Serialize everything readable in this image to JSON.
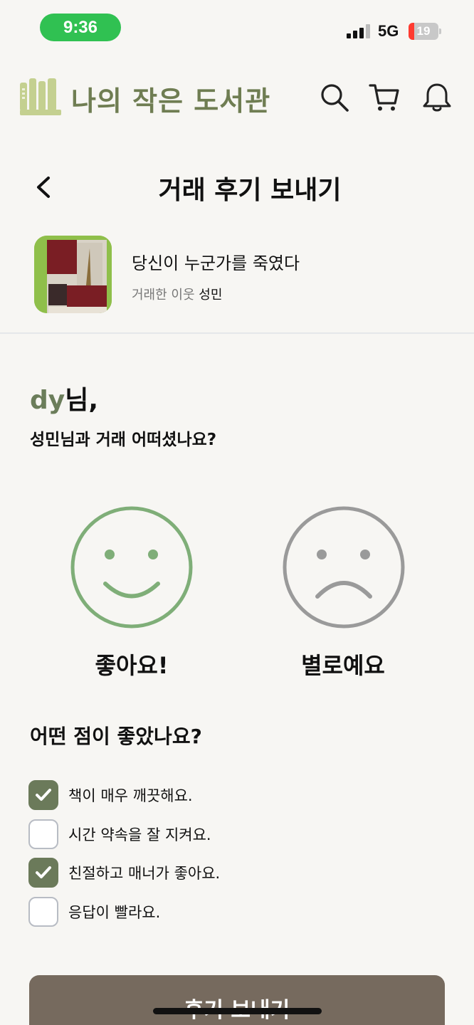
{
  "status_bar": {
    "time": "9:36",
    "network": "5G",
    "battery": "19",
    "battery_level": 0.19
  },
  "header": {
    "app_title": "나의 작은 도서관"
  },
  "page": {
    "title": "거래 후기 보내기"
  },
  "book": {
    "title": "당신이 누군가를 죽였다",
    "neighbor_label": "거래한 이웃",
    "neighbor_name": "성민"
  },
  "greeting": {
    "user": "dy",
    "suffix": "님,",
    "question": "성민님과 거래 어떠셨나요?"
  },
  "ratings": {
    "good_label": "좋아요!",
    "bad_label": "별로예요",
    "selected": "good"
  },
  "feedback": {
    "question": "어떤 점이 좋았나요?",
    "options": [
      {
        "label": "책이 매우 깨끗해요.",
        "checked": true
      },
      {
        "label": "시간 약속을 잘 지켜요.",
        "checked": false
      },
      {
        "label": "친절하고 매너가 좋아요.",
        "checked": true
      },
      {
        "label": "응답이 빨라요.",
        "checked": false
      }
    ]
  },
  "submit": {
    "label": "후기 보내기"
  },
  "colors": {
    "accent": "#6b7a5a",
    "good_face": "#7fae78",
    "bad_face": "#9a9a9a",
    "button": "#766a5e",
    "logo": "#c4d090"
  },
  "icons": [
    "logo-icon",
    "search-icon",
    "cart-icon",
    "bell-icon",
    "back-icon",
    "smile-icon",
    "frown-icon",
    "check-icon"
  ]
}
